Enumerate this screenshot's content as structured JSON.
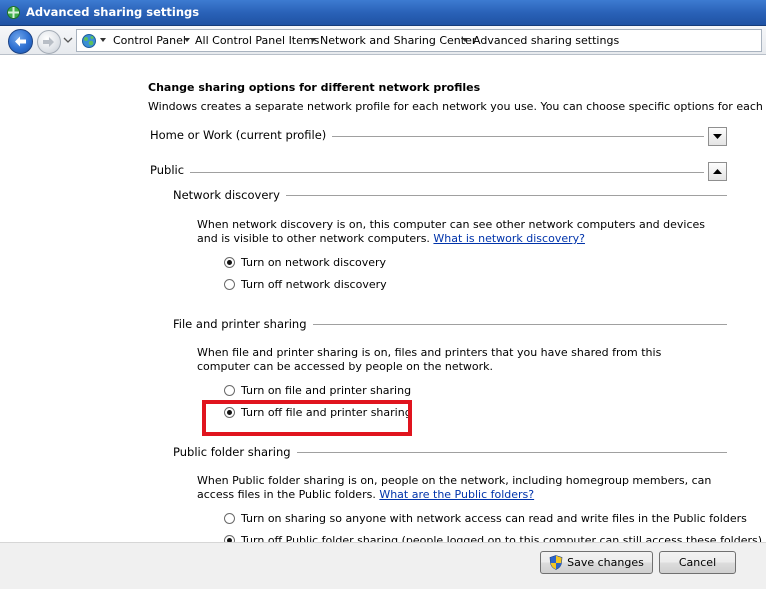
{
  "window": {
    "title": "Advanced sharing settings"
  },
  "breadcrumb": {
    "items": [
      "Control Panel",
      "All Control Panel Items",
      "Network and Sharing Center",
      "Advanced sharing settings"
    ]
  },
  "main": {
    "heading": "Change sharing options for different network profiles",
    "subheading": "Windows creates a separate network profile for each network you use. You can choose specific options for each profile.",
    "profiles": {
      "home_work": "Home or Work (current profile)",
      "public": "Public"
    },
    "network_discovery": {
      "title": "Network discovery",
      "desc": "When network discovery is on, this computer can see other network computers and devices and is visible to other network computers.",
      "link": "What is network discovery?",
      "opt_on": "Turn on network discovery",
      "opt_off": "Turn off network discovery"
    },
    "file_printer": {
      "title": "File and printer sharing",
      "desc": "When file and printer sharing is on, files and printers that you have shared from this computer can be accessed by people on the network.",
      "opt_on": "Turn on file and printer sharing",
      "opt_off": "Turn off file and printer sharing"
    },
    "public_folder": {
      "title": "Public folder sharing",
      "desc": "When Public folder sharing is on, people on the network, including homegroup members, can access files in the Public folders.",
      "link": "What are the Public folders?",
      "opt_on": "Turn on sharing so anyone with network access can read and write files in the Public folders",
      "opt_off": "Turn off Public folder sharing (people logged on to this computer can still access these folders)"
    }
  },
  "footer": {
    "save": "Save changes",
    "cancel": "Cancel"
  }
}
